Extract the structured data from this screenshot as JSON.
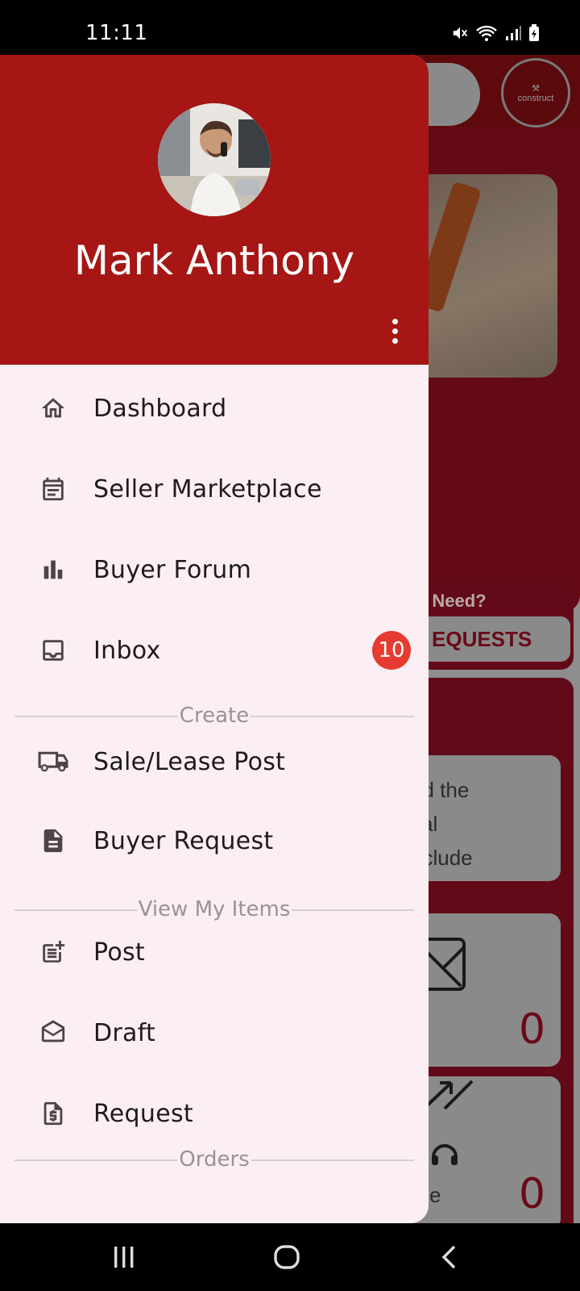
{
  "status_bar": {
    "time": "11:11"
  },
  "drawer": {
    "user_name": "Mark Anthony",
    "menu": [
      {
        "label": "Dashboard",
        "icon": "home-icon"
      },
      {
        "label": "Seller Marketplace",
        "icon": "calendar-icon"
      },
      {
        "label": "Buyer Forum",
        "icon": "bar-chart-icon"
      },
      {
        "label": "Inbox",
        "icon": "inbox-icon",
        "badge": "10"
      }
    ],
    "section_create": "Create",
    "create_items": [
      {
        "label": "Sale/Lease Post",
        "icon": "truck-icon"
      },
      {
        "label": "Buyer Request",
        "icon": "document-icon"
      }
    ],
    "section_view": "View My Items",
    "view_items": [
      {
        "label": "Post",
        "icon": "post-add-icon"
      },
      {
        "label": "Draft",
        "icon": "drafts-icon"
      },
      {
        "label": "Request",
        "icon": "request-quote-icon"
      }
    ],
    "section_orders": "Orders"
  },
  "background": {
    "logo_text": "construct",
    "need_text": "a Need?",
    "requests_button": "EQUESTS",
    "card_text": [
      "ed the",
      "tial",
      "nclude"
    ],
    "counts": [
      "0",
      "0"
    ],
    "partial_label": "ce"
  },
  "colors": {
    "header_red": "#a51614",
    "drawer_bg": "#fbeff3",
    "badge_red": "#e53b30",
    "icon_dark": "#4e4446"
  }
}
